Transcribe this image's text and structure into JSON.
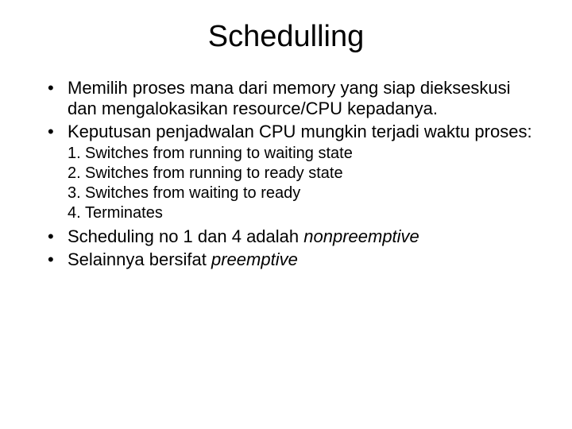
{
  "title": "Schedulling",
  "bullets": {
    "b1": "Memilih proses mana dari memory yang siap diekseskusi dan mengalokasikan resource/CPU kepadanya.",
    "b2": "Keputusan penjadwalan CPU mungkin terjadi waktu proses:",
    "b3_pre": "Scheduling no 1 dan 4 adalah ",
    "b3_em": "nonpreemptive",
    "b4_pre": "Selainnya bersifat ",
    "b4_em": "preemptive"
  },
  "sub": {
    "n1": "1.",
    "t1": "Switches from running to waiting state",
    "n2": "2.",
    "t2": "Switches from running to ready state",
    "n3": "3.",
    "t3": "Switches from waiting to ready",
    "n4": "4.",
    "t4": "Terminates"
  },
  "mark": "•"
}
